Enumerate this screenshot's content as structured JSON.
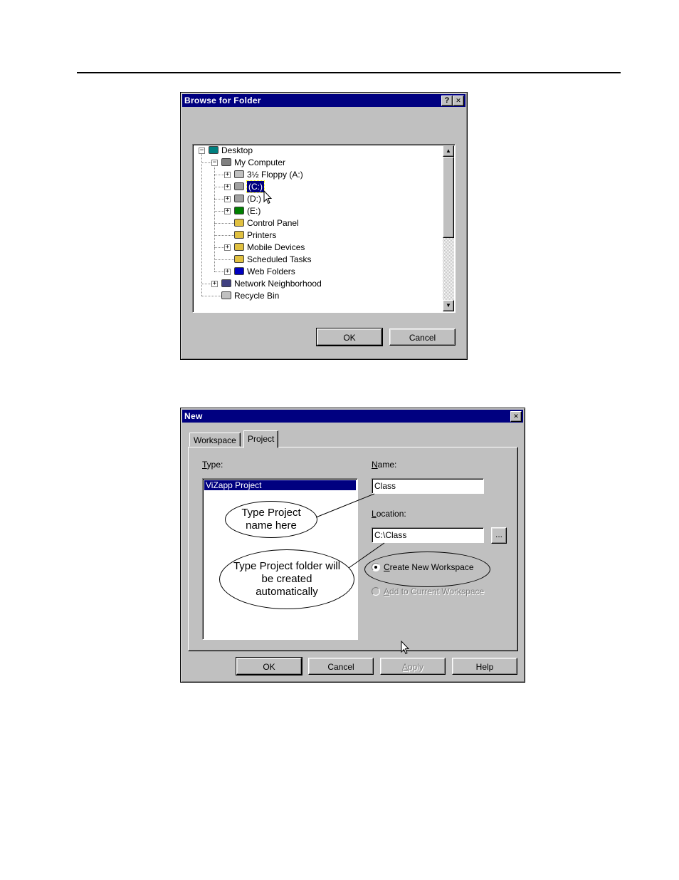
{
  "browse_dialog": {
    "title": "Browse for Folder",
    "help_btn": "?",
    "close_btn": "✕",
    "tree": [
      {
        "label": "Desktop",
        "icon": "desktop-icon"
      },
      {
        "label": "My Computer",
        "icon": "computer-icon"
      },
      {
        "label": "3½ Floppy (A:)",
        "icon": "floppy-drive-icon"
      },
      {
        "label": "(C:)",
        "icon": "hard-drive-icon",
        "selected": true
      },
      {
        "label": "(D:)",
        "icon": "hard-drive-icon"
      },
      {
        "label": "(E:)",
        "icon": "network-drive-icon"
      },
      {
        "label": "Control Panel",
        "icon": "control-panel-icon"
      },
      {
        "label": "Printers",
        "icon": "printers-icon"
      },
      {
        "label": "Mobile Devices",
        "icon": "mobile-devices-icon"
      },
      {
        "label": "Scheduled Tasks",
        "icon": "scheduled-tasks-icon"
      },
      {
        "label": "Web Folders",
        "icon": "web-folders-icon"
      },
      {
        "label": "Network Neighborhood",
        "icon": "network-icon"
      },
      {
        "label": "Recycle Bin",
        "icon": "recycle-bin-icon"
      }
    ],
    "ok": "OK",
    "cancel": "Cancel"
  },
  "new_dialog": {
    "title": "New",
    "close_btn": "✕",
    "tabs": [
      "Workspace",
      "Project"
    ],
    "active_tab": "Project",
    "type_label": "Type:",
    "type_label_u": "T",
    "type_label_rest": "ype:",
    "type_items": [
      "ViZapp Project"
    ],
    "name_label_u": "N",
    "name_label_rest": "ame:",
    "name_value": "Class",
    "location_label_u": "L",
    "location_label_rest": "ocation:",
    "location_value": "C:\\Class",
    "browse_btn": "...",
    "radio_create_u": "C",
    "radio_create_rest": "reate New Workspace",
    "radio_add_u": "A",
    "radio_add_rest": "dd to Current Workspace",
    "callout_name": "Type Project name here",
    "callout_folder": "Type Project folder will be created automatically",
    "ok": "OK",
    "cancel": "Cancel",
    "apply_u": "A",
    "apply_rest": "pply",
    "help": "Help"
  }
}
